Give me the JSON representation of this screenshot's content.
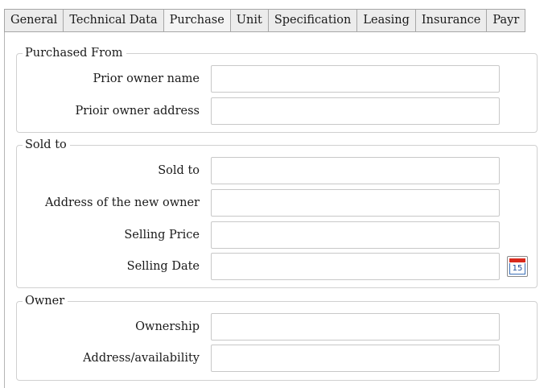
{
  "tabs": [
    {
      "label": "General"
    },
    {
      "label": "Technical Data"
    },
    {
      "label": "Purchase"
    },
    {
      "label": "Unit"
    },
    {
      "label": "Specification"
    },
    {
      "label": "Leasing"
    },
    {
      "label": "Insurance"
    },
    {
      "label": "Payr"
    }
  ],
  "purchased_from": {
    "title": "Purchased From",
    "prior_owner_name": {
      "label": "Prior owner name",
      "value": ""
    },
    "prior_owner_address": {
      "label": "Prioir owner address",
      "value": ""
    }
  },
  "sold_to": {
    "title": "Sold to",
    "sold_to": {
      "label": "Sold to",
      "value": ""
    },
    "new_owner_address": {
      "label": "Address of the new owner",
      "value": ""
    },
    "selling_price": {
      "label": "Selling Price",
      "value": ""
    },
    "selling_date": {
      "label": "Selling Date",
      "value": ""
    },
    "calendar_day": "15"
  },
  "owner": {
    "title": "Owner",
    "ownership": {
      "label": "Ownership",
      "value": ""
    },
    "address_availability": {
      "label": "Address/availability",
      "value": ""
    }
  },
  "colors": {
    "calendar_red": "#d92a1c",
    "calendar_blue": "#3a6fb7",
    "tab_bg": "#ececec"
  }
}
